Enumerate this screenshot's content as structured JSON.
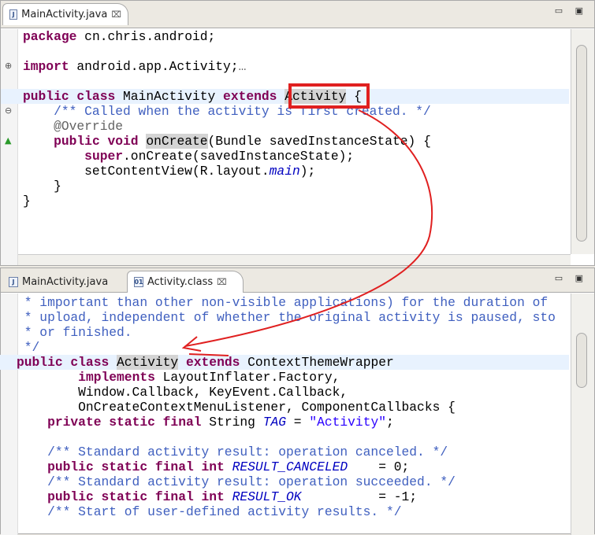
{
  "top_pane": {
    "tab": {
      "label": "MainActivity.java",
      "icon": "java-file-icon",
      "close": "⌧"
    },
    "lines": [
      [
        [
          "package",
          "k"
        ],
        [
          " cn.chris.android;",
          ""
        ]
      ],
      [],
      [
        [
          "import",
          "k"
        ],
        [
          " android.app.Activity;",
          ""
        ],
        [
          "…",
          "a"
        ]
      ],
      [],
      [
        [
          "public class",
          "k"
        ],
        [
          " MainActivity ",
          ""
        ],
        [
          "extends",
          "k"
        ],
        [
          " ",
          ""
        ],
        [
          "Activity",
          "h"
        ],
        [
          " {",
          ""
        ]
      ],
      [
        [
          "    /** Called when the activity is first created. */",
          "c"
        ]
      ],
      [
        [
          "    @Override",
          "a"
        ]
      ],
      [
        [
          "    ",
          ""
        ],
        [
          "public void",
          "k"
        ],
        [
          " ",
          ""
        ],
        [
          "onCreate",
          "h"
        ],
        [
          "(Bundle savedInstanceState) {",
          ""
        ]
      ],
      [
        [
          "        ",
          ""
        ],
        [
          "super",
          "k"
        ],
        [
          ".onCreate(savedInstanceState);",
          ""
        ]
      ],
      [
        [
          "        setContentView(R.layout.",
          ""
        ],
        [
          "main",
          "f"
        ],
        [
          ");",
          ""
        ]
      ],
      [
        [
          "    }",
          ""
        ]
      ],
      [
        [
          "}",
          ""
        ]
      ]
    ],
    "current_line": 4
  },
  "bottom_pane": {
    "tabs": [
      {
        "label": "MainActivity.java",
        "icon": "java-file-icon"
      },
      {
        "label": "Activity.class",
        "icon": "class-file-icon",
        "close": "⌧"
      }
    ],
    "lines": [
      [
        [
          " * important than other non-visible applications) for the duration of",
          "c"
        ]
      ],
      [
        [
          " * upload, independent of whether the original activity is paused, sto",
          "c"
        ]
      ],
      [
        [
          " * or finished.",
          "c"
        ]
      ],
      [
        [
          " */",
          "c"
        ]
      ],
      [
        [
          "public class",
          "k"
        ],
        [
          " ",
          ""
        ],
        [
          "Activity",
          "h"
        ],
        [
          " ",
          ""
        ],
        [
          "extends",
          "k"
        ],
        [
          " ContextThemeWrapper",
          ""
        ]
      ],
      [
        [
          "        ",
          ""
        ],
        [
          "implements",
          "k"
        ],
        [
          " LayoutInflater.Factory,",
          ""
        ]
      ],
      [
        [
          "        Window.Callback, KeyEvent.Callback,",
          ""
        ]
      ],
      [
        [
          "        OnCreateContextMenuListener, ComponentCallbacks {",
          ""
        ]
      ],
      [
        [
          "    ",
          ""
        ],
        [
          "private static final",
          "k"
        ],
        [
          " String ",
          ""
        ],
        [
          "TAG",
          "f"
        ],
        [
          " = ",
          ""
        ],
        [
          "\"Activity\"",
          "s"
        ],
        [
          ";",
          ""
        ]
      ],
      [],
      [
        [
          "    /** Standard activity result: operation canceled. */",
          "c"
        ]
      ],
      [
        [
          "    ",
          ""
        ],
        [
          "public static final int",
          "k"
        ],
        [
          " ",
          ""
        ],
        [
          "RESULT_CANCELED",
          "f"
        ],
        [
          "    = 0;",
          ""
        ]
      ],
      [
        [
          "    /** Standard activity result: operation succeeded. */",
          "c"
        ]
      ],
      [
        [
          "    ",
          ""
        ],
        [
          "public static final int",
          "k"
        ],
        [
          " ",
          ""
        ],
        [
          "RESULT_OK",
          "f"
        ],
        [
          "          = -1;",
          ""
        ]
      ],
      [
        [
          "    /** Start of user-defined activity results. */",
          "c"
        ]
      ]
    ],
    "current_line": 4
  },
  "annotation_color": "#e02020"
}
